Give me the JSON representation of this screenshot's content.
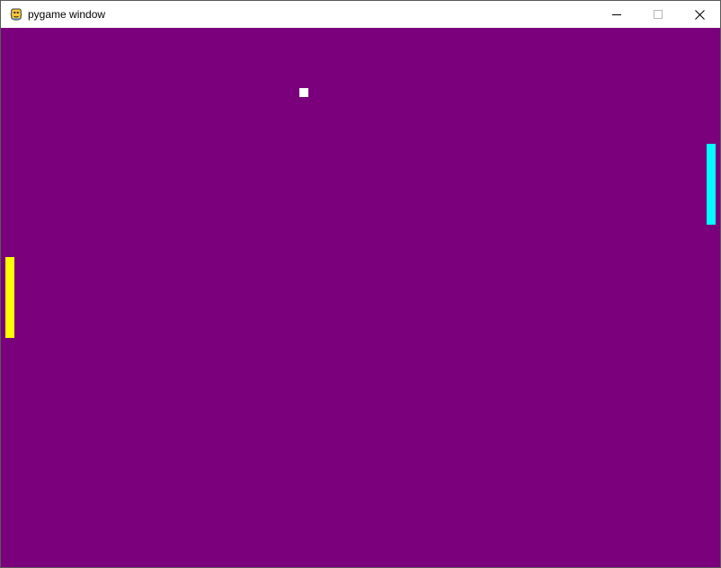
{
  "window": {
    "title": "pygame window",
    "app_icon": "pygame-snake-icon",
    "controls": {
      "minimize_icon": "minimize-icon",
      "maximize_icon": "maximize-icon",
      "close_icon": "close-icon"
    }
  },
  "game": {
    "background_color": "#7b007b",
    "left_paddle": {
      "color": "#ffff00"
    },
    "right_paddle": {
      "color": "#00ffff"
    },
    "ball": {
      "color": "#ffffff"
    }
  }
}
